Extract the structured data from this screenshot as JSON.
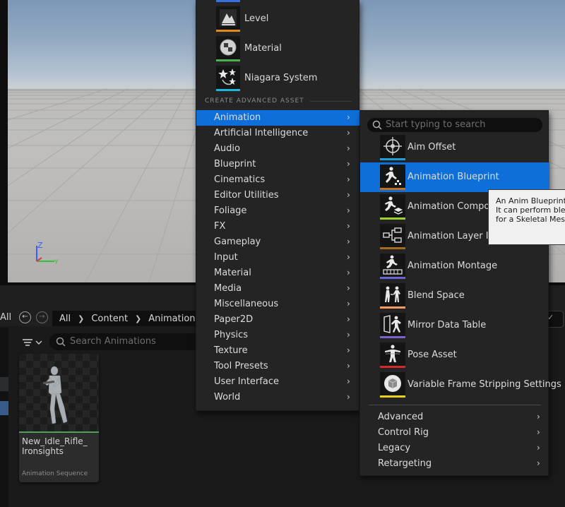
{
  "left_menu": {
    "top_items": [
      {
        "label": "Level",
        "icon": "level-icon",
        "color": "#e08a1e"
      },
      {
        "label": "Material",
        "icon": "material-icon",
        "color": "#4caf50"
      },
      {
        "label": "Niagara System",
        "icon": "niagara-icon",
        "color": "#1fb6d9"
      }
    ],
    "section_header": "CREATE ADVANCED ASSET",
    "categories": [
      "Animation",
      "Artificial Intelligence",
      "Audio",
      "Blueprint",
      "Cinematics",
      "Editor Utilities",
      "Foliage",
      "FX",
      "Gameplay",
      "Input",
      "Material",
      "Media",
      "Miscellaneous",
      "Paper2D",
      "Physics",
      "Texture",
      "Tool Presets",
      "User Interface",
      "World"
    ],
    "selected_category": "Animation",
    "chevron": "›"
  },
  "submenu": {
    "search_placeholder": "Start typing to search",
    "items": [
      {
        "label": "Aim Offset",
        "icon": "aim-offset-icon",
        "color": "#1f9ed9"
      },
      {
        "label": "Animation Blueprint",
        "icon": "animation-blueprint-icon",
        "color": "#c76f1c"
      },
      {
        "label": "Animation Composite",
        "icon": "animation-composite-icon",
        "color": "#9bd22b"
      },
      {
        "label": "Animation Layer Interface",
        "icon": "animation-layer-interface-icon",
        "color": "#a56c1d"
      },
      {
        "label": "Animation Montage",
        "icon": "animation-montage-icon",
        "color": "#6c63d6"
      },
      {
        "label": "Blend Space",
        "icon": "blend-space-icon",
        "color": "#f29a62"
      },
      {
        "label": "Mirror Data Table",
        "icon": "mirror-data-table-icon",
        "color": "#7a63c9"
      },
      {
        "label": "Pose Asset",
        "icon": "pose-asset-icon",
        "color": "#d22b2b"
      },
      {
        "label": "Variable Frame Stripping Settings",
        "icon": "variable-frame-stripping-icon",
        "color": "#e6d21e"
      }
    ],
    "selected_item": "Animation Blueprint",
    "categories": [
      "Advanced",
      "Control Rig",
      "Legacy",
      "Retargeting"
    ]
  },
  "tooltip": {
    "lines": [
      "An Anim Blueprint",
      "It can perform blen",
      "for a Skeletal Mesh"
    ]
  },
  "content_browser": {
    "all_label": "All",
    "breadcrumbs": [
      "All",
      "Content",
      "Animations"
    ],
    "search_placeholder": "Search Animations",
    "asset": {
      "name": "New_Idle_Rifle_ Ironsights",
      "type": "Animation Sequence",
      "type_color": "#49a35b"
    }
  },
  "viewport": {
    "gizmo_z_label": "Z"
  }
}
